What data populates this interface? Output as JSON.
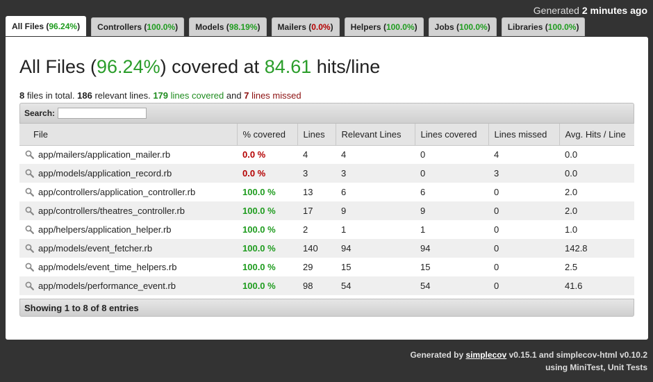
{
  "header": {
    "generated_prefix": "Generated",
    "generated_time": "2 minutes ago"
  },
  "tabs": [
    {
      "label": "All Files",
      "pct": "96.24%",
      "color": "green",
      "active": true
    },
    {
      "label": "Controllers",
      "pct": "100.0%",
      "color": "green",
      "active": false
    },
    {
      "label": "Models",
      "pct": "98.19%",
      "color": "green",
      "active": false
    },
    {
      "label": "Mailers",
      "pct": "0.0%",
      "color": "red",
      "active": false
    },
    {
      "label": "Helpers",
      "pct": "100.0%",
      "color": "green",
      "active": false
    },
    {
      "label": "Jobs",
      "pct": "100.0%",
      "color": "green",
      "active": false
    },
    {
      "label": "Libraries",
      "pct": "100.0%",
      "color": "green",
      "active": false
    }
  ],
  "main": {
    "title": "All Files",
    "title_pct": "96.24%",
    "title_mid": "covered at",
    "title_hits": "84.61",
    "title_suffix": "hits/line",
    "summary": {
      "files_count": "8",
      "files_text": "files in total.",
      "relevant_count": "186",
      "relevant_text": "relevant lines.",
      "covered_count": "179",
      "covered_text": "lines covered",
      "and_text": "and",
      "missed_count": "7",
      "missed_text": "lines missed"
    },
    "search_label": "Search:",
    "search_value": "",
    "columns": [
      "File",
      "% covered",
      "Lines",
      "Relevant Lines",
      "Lines covered",
      "Lines missed",
      "Avg. Hits / Line"
    ],
    "rows": [
      {
        "file": "app/mailers/application_mailer.rb",
        "pct": "0.0 %",
        "color": "red",
        "lines": "4",
        "relevant": "4",
        "covered": "0",
        "missed": "4",
        "avg": "0.0"
      },
      {
        "file": "app/models/application_record.rb",
        "pct": "0.0 %",
        "color": "red",
        "lines": "3",
        "relevant": "3",
        "covered": "0",
        "missed": "3",
        "avg": "0.0"
      },
      {
        "file": "app/controllers/application_controller.rb",
        "pct": "100.0 %",
        "color": "green",
        "lines": "13",
        "relevant": "6",
        "covered": "6",
        "missed": "0",
        "avg": "2.0"
      },
      {
        "file": "app/controllers/theatres_controller.rb",
        "pct": "100.0 %",
        "color": "green",
        "lines": "17",
        "relevant": "9",
        "covered": "9",
        "missed": "0",
        "avg": "2.0"
      },
      {
        "file": "app/helpers/application_helper.rb",
        "pct": "100.0 %",
        "color": "green",
        "lines": "2",
        "relevant": "1",
        "covered": "1",
        "missed": "0",
        "avg": "1.0"
      },
      {
        "file": "app/models/event_fetcher.rb",
        "pct": "100.0 %",
        "color": "green",
        "lines": "140",
        "relevant": "94",
        "covered": "94",
        "missed": "0",
        "avg": "142.8"
      },
      {
        "file": "app/models/event_time_helpers.rb",
        "pct": "100.0 %",
        "color": "green",
        "lines": "29",
        "relevant": "15",
        "covered": "15",
        "missed": "0",
        "avg": "2.5"
      },
      {
        "file": "app/models/performance_event.rb",
        "pct": "100.0 %",
        "color": "green",
        "lines": "98",
        "relevant": "54",
        "covered": "54",
        "missed": "0",
        "avg": "41.6"
      }
    ],
    "showing_text": "Showing 1 to 8 of 8 entries"
  },
  "footer": {
    "generated_by": "Generated by",
    "simplecov_link": "simplecov",
    "version_text": "v0.15.1 and simplecov-html v0.10.2",
    "using_text": "using MiniTest, Unit Tests"
  },
  "colors": {
    "background": "#333333",
    "green": "#1f9c1f",
    "red": "#b40000",
    "row_stripe": "#efefef"
  },
  "icons": {
    "file_row": "magnifier-icon"
  }
}
